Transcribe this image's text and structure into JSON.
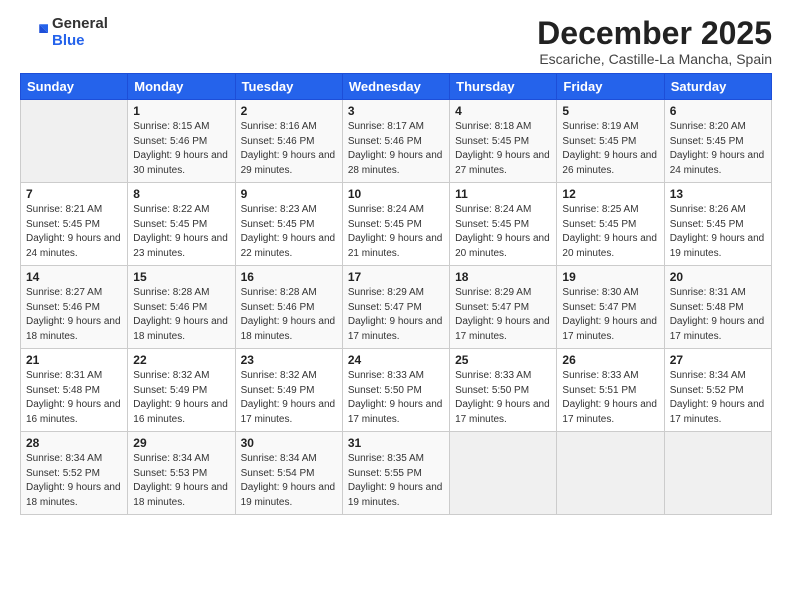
{
  "logo": {
    "general": "General",
    "blue": "Blue"
  },
  "header": {
    "month": "December 2025",
    "location": "Escariche, Castille-La Mancha, Spain"
  },
  "weekdays": [
    "Sunday",
    "Monday",
    "Tuesday",
    "Wednesday",
    "Thursday",
    "Friday",
    "Saturday"
  ],
  "weeks": [
    [
      {
        "day": "",
        "sunrise": "",
        "sunset": "",
        "daylight": ""
      },
      {
        "day": "1",
        "sunrise": "Sunrise: 8:15 AM",
        "sunset": "Sunset: 5:46 PM",
        "daylight": "Daylight: 9 hours and 30 minutes."
      },
      {
        "day": "2",
        "sunrise": "Sunrise: 8:16 AM",
        "sunset": "Sunset: 5:46 PM",
        "daylight": "Daylight: 9 hours and 29 minutes."
      },
      {
        "day": "3",
        "sunrise": "Sunrise: 8:17 AM",
        "sunset": "Sunset: 5:46 PM",
        "daylight": "Daylight: 9 hours and 28 minutes."
      },
      {
        "day": "4",
        "sunrise": "Sunrise: 8:18 AM",
        "sunset": "Sunset: 5:45 PM",
        "daylight": "Daylight: 9 hours and 27 minutes."
      },
      {
        "day": "5",
        "sunrise": "Sunrise: 8:19 AM",
        "sunset": "Sunset: 5:45 PM",
        "daylight": "Daylight: 9 hours and 26 minutes."
      },
      {
        "day": "6",
        "sunrise": "Sunrise: 8:20 AM",
        "sunset": "Sunset: 5:45 PM",
        "daylight": "Daylight: 9 hours and 24 minutes."
      }
    ],
    [
      {
        "day": "7",
        "sunrise": "Sunrise: 8:21 AM",
        "sunset": "Sunset: 5:45 PM",
        "daylight": "Daylight: 9 hours and 24 minutes."
      },
      {
        "day": "8",
        "sunrise": "Sunrise: 8:22 AM",
        "sunset": "Sunset: 5:45 PM",
        "daylight": "Daylight: 9 hours and 23 minutes."
      },
      {
        "day": "9",
        "sunrise": "Sunrise: 8:23 AM",
        "sunset": "Sunset: 5:45 PM",
        "daylight": "Daylight: 9 hours and 22 minutes."
      },
      {
        "day": "10",
        "sunrise": "Sunrise: 8:24 AM",
        "sunset": "Sunset: 5:45 PM",
        "daylight": "Daylight: 9 hours and 21 minutes."
      },
      {
        "day": "11",
        "sunrise": "Sunrise: 8:24 AM",
        "sunset": "Sunset: 5:45 PM",
        "daylight": "Daylight: 9 hours and 20 minutes."
      },
      {
        "day": "12",
        "sunrise": "Sunrise: 8:25 AM",
        "sunset": "Sunset: 5:45 PM",
        "daylight": "Daylight: 9 hours and 20 minutes."
      },
      {
        "day": "13",
        "sunrise": "Sunrise: 8:26 AM",
        "sunset": "Sunset: 5:45 PM",
        "daylight": "Daylight: 9 hours and 19 minutes."
      }
    ],
    [
      {
        "day": "14",
        "sunrise": "Sunrise: 8:27 AM",
        "sunset": "Sunset: 5:46 PM",
        "daylight": "Daylight: 9 hours and 18 minutes."
      },
      {
        "day": "15",
        "sunrise": "Sunrise: 8:28 AM",
        "sunset": "Sunset: 5:46 PM",
        "daylight": "Daylight: 9 hours and 18 minutes."
      },
      {
        "day": "16",
        "sunrise": "Sunrise: 8:28 AM",
        "sunset": "Sunset: 5:46 PM",
        "daylight": "Daylight: 9 hours and 18 minutes."
      },
      {
        "day": "17",
        "sunrise": "Sunrise: 8:29 AM",
        "sunset": "Sunset: 5:47 PM",
        "daylight": "Daylight: 9 hours and 17 minutes."
      },
      {
        "day": "18",
        "sunrise": "Sunrise: 8:29 AM",
        "sunset": "Sunset: 5:47 PM",
        "daylight": "Daylight: 9 hours and 17 minutes."
      },
      {
        "day": "19",
        "sunrise": "Sunrise: 8:30 AM",
        "sunset": "Sunset: 5:47 PM",
        "daylight": "Daylight: 9 hours and 17 minutes."
      },
      {
        "day": "20",
        "sunrise": "Sunrise: 8:31 AM",
        "sunset": "Sunset: 5:48 PM",
        "daylight": "Daylight: 9 hours and 17 minutes."
      }
    ],
    [
      {
        "day": "21",
        "sunrise": "Sunrise: 8:31 AM",
        "sunset": "Sunset: 5:48 PM",
        "daylight": "Daylight: 9 hours and 16 minutes."
      },
      {
        "day": "22",
        "sunrise": "Sunrise: 8:32 AM",
        "sunset": "Sunset: 5:49 PM",
        "daylight": "Daylight: 9 hours and 16 minutes."
      },
      {
        "day": "23",
        "sunrise": "Sunrise: 8:32 AM",
        "sunset": "Sunset: 5:49 PM",
        "daylight": "Daylight: 9 hours and 17 minutes."
      },
      {
        "day": "24",
        "sunrise": "Sunrise: 8:33 AM",
        "sunset": "Sunset: 5:50 PM",
        "daylight": "Daylight: 9 hours and 17 minutes."
      },
      {
        "day": "25",
        "sunrise": "Sunrise: 8:33 AM",
        "sunset": "Sunset: 5:50 PM",
        "daylight": "Daylight: 9 hours and 17 minutes."
      },
      {
        "day": "26",
        "sunrise": "Sunrise: 8:33 AM",
        "sunset": "Sunset: 5:51 PM",
        "daylight": "Daylight: 9 hours and 17 minutes."
      },
      {
        "day": "27",
        "sunrise": "Sunrise: 8:34 AM",
        "sunset": "Sunset: 5:52 PM",
        "daylight": "Daylight: 9 hours and 17 minutes."
      }
    ],
    [
      {
        "day": "28",
        "sunrise": "Sunrise: 8:34 AM",
        "sunset": "Sunset: 5:52 PM",
        "daylight": "Daylight: 9 hours and 18 minutes."
      },
      {
        "day": "29",
        "sunrise": "Sunrise: 8:34 AM",
        "sunset": "Sunset: 5:53 PM",
        "daylight": "Daylight: 9 hours and 18 minutes."
      },
      {
        "day": "30",
        "sunrise": "Sunrise: 8:34 AM",
        "sunset": "Sunset: 5:54 PM",
        "daylight": "Daylight: 9 hours and 19 minutes."
      },
      {
        "day": "31",
        "sunrise": "Sunrise: 8:35 AM",
        "sunset": "Sunset: 5:55 PM",
        "daylight": "Daylight: 9 hours and 19 minutes."
      },
      {
        "day": "",
        "sunrise": "",
        "sunset": "",
        "daylight": ""
      },
      {
        "day": "",
        "sunrise": "",
        "sunset": "",
        "daylight": ""
      },
      {
        "day": "",
        "sunrise": "",
        "sunset": "",
        "daylight": ""
      }
    ]
  ]
}
